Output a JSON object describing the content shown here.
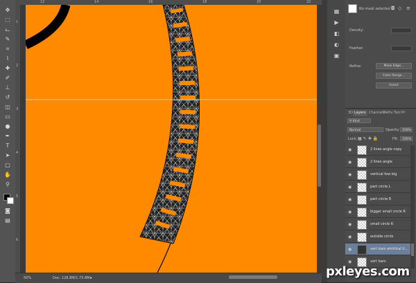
{
  "status": {
    "zoom": "50%",
    "doc_info": "Doc: 128.8M/1.75.8M"
  },
  "rulers": {
    "top": [
      "12",
      "14",
      "16",
      "18",
      "20",
      "22"
    ],
    "left": [
      "1",
      "2",
      "3",
      "4",
      "5",
      "6"
    ]
  },
  "properties": {
    "mask_label": "No mask selected",
    "density_label": "Density:",
    "feather_label": "Feather:",
    "refine_label": "Refine:",
    "mask_edge_btn": "Mask Edge...",
    "color_range_btn": "Color Range...",
    "invert_btn": "Invert"
  },
  "layers_panel": {
    "tabs": [
      "3D",
      "Layers",
      "Channels",
      "Paths",
      "Tool Pr"
    ],
    "kind": "Kind",
    "blend_mode": "Normal",
    "opacity_label": "Opacity:",
    "opacity_value": "100%",
    "lock_label": "Lock:",
    "fill_label": "Fill:",
    "fill_value": "100%",
    "layers": [
      {
        "name": "2 lines angle copy"
      },
      {
        "name": "2 lines angle"
      },
      {
        "name": "vertical few big"
      },
      {
        "name": "part circle L"
      },
      {
        "name": "part circle R"
      },
      {
        "name": "bigger small circle R"
      },
      {
        "name": "small circle R"
      },
      {
        "name": "outside circle"
      },
      {
        "name": "vert bars whirlical li...",
        "selected": true
      },
      {
        "name": "vert bars"
      }
    ]
  },
  "watermark": "pxleyes.com",
  "colors": {
    "canvas": "#FF8A00",
    "selected_layer": "#6b7f9a",
    "guide": "#9fd3d3"
  }
}
